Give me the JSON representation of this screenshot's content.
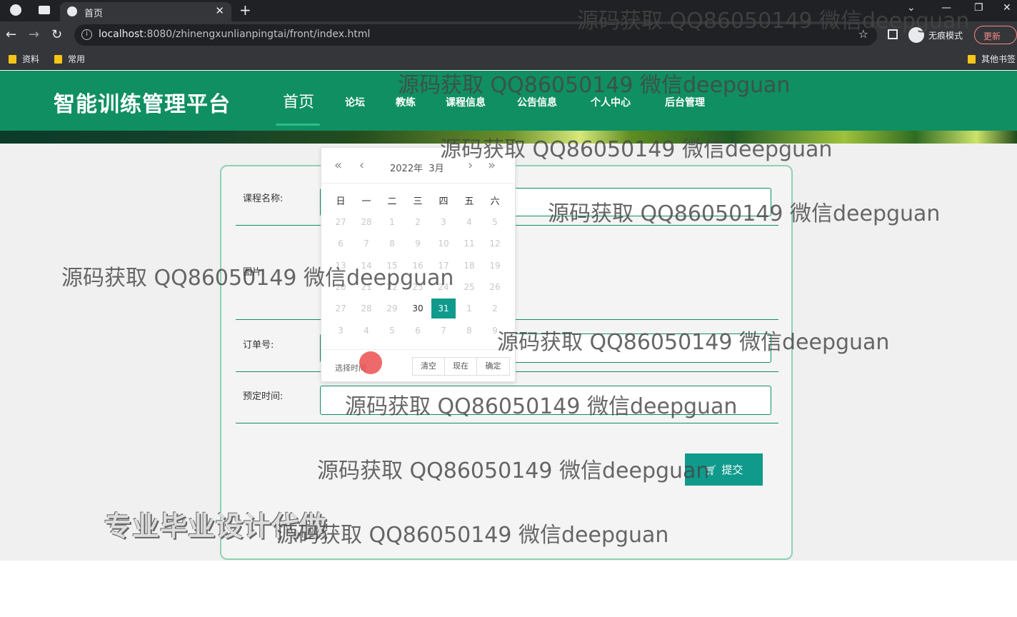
{
  "browser": {
    "tab_title": "首页",
    "url_host": "localhost",
    "url_rest": ":8080/zhinengxunlianpingtai/front/index.html",
    "incognito_label": "无痕模式",
    "update_label": "更新",
    "bookmarks": [
      "资料",
      "常用"
    ],
    "other_bookmarks": "其他书签"
  },
  "site": {
    "title": "智能训练管理平台",
    "nav": [
      "首页",
      "论坛",
      "教练",
      "课程信息",
      "公告信息",
      "个人中心",
      "后台管理"
    ]
  },
  "form": {
    "course_name_label": "课程名称:",
    "image_label": "图片:",
    "order_no_label": "订单号:",
    "reserve_time_label": "预定时间:",
    "submit_label": "提交"
  },
  "datepicker": {
    "year": "2022年",
    "month": "3月",
    "weekdays": [
      "日",
      "一",
      "二",
      "三",
      "四",
      "五",
      "六"
    ],
    "weeks": [
      [
        "27",
        "28",
        "1",
        "2",
        "3",
        "4",
        "5"
      ],
      [
        "6",
        "7",
        "8",
        "9",
        "10",
        "11",
        "12"
      ],
      [
        "13",
        "14",
        "15",
        "16",
        "17",
        "18",
        "19"
      ],
      [
        "20",
        "21",
        "22",
        "23",
        "24",
        "25",
        "26"
      ],
      [
        "27",
        "28",
        "29",
        "30",
        "31",
        "1",
        "2"
      ],
      [
        "3",
        "4",
        "5",
        "6",
        "7",
        "8",
        "9"
      ]
    ],
    "select_time_label": "选择时间",
    "buttons": [
      "清空",
      "现在",
      "确定"
    ]
  },
  "promo_text": "专业毕业设计代做",
  "watermark": "源码获取 QQ86050149 微信deepguan"
}
